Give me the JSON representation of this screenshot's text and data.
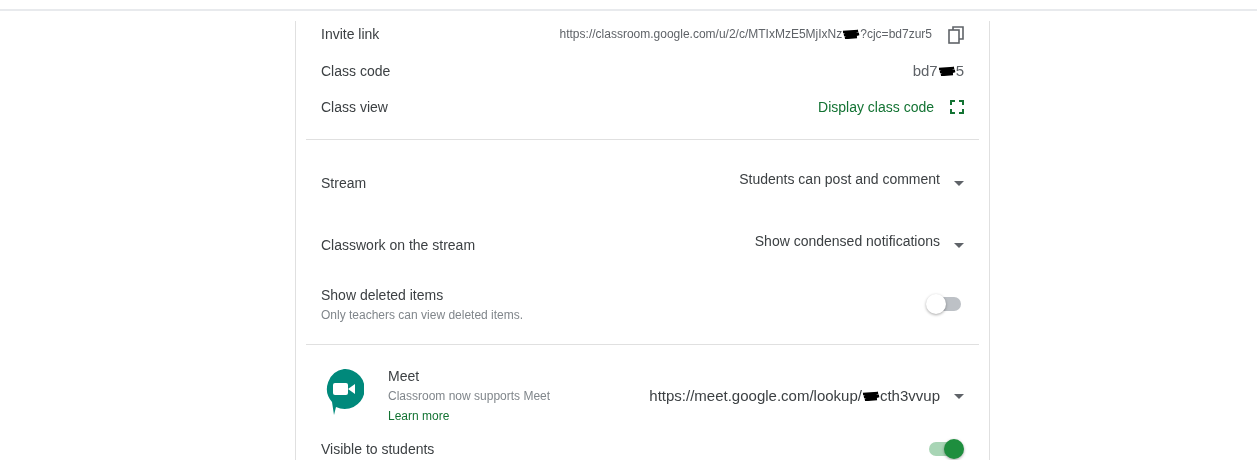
{
  "general": {
    "invite_link": {
      "label": "Invite link",
      "value_parts": [
        "https://classroom.google.com/u/2/c/MTIxMzE5MjIxNz",
        "?cjc=bd7zur5"
      ]
    },
    "class_code": {
      "label": "Class code",
      "value_parts": [
        "bd7",
        "5"
      ]
    },
    "class_view": {
      "label": "Class view",
      "link": "Display class code"
    }
  },
  "stream_settings": [
    {
      "kind": "dropdown",
      "label": "Stream",
      "value": "Students can post and comment"
    },
    {
      "kind": "dropdown",
      "label": "Classwork on the stream",
      "value": "Show condensed notifications"
    },
    {
      "kind": "toggle",
      "label": "Show deleted items",
      "description": "Only teachers can view deleted items.",
      "on": false
    }
  ],
  "meet": {
    "title": "Meet",
    "description": "Classroom now supports Meet",
    "learn_more": "Learn more",
    "link_parts": [
      "https://meet.google.com/lookup/",
      "cth3vvup"
    ],
    "visible": {
      "label": "Visible to students",
      "on": true
    }
  }
}
